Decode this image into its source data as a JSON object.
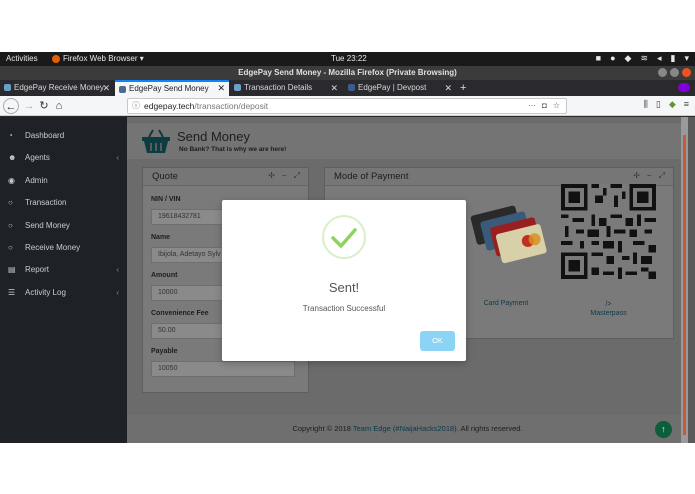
{
  "desktop": {
    "activities": "Activities",
    "app_menu": "Firefox Web Browser ▾",
    "clock": "Tue 23:22"
  },
  "window": {
    "title": "EdgePay Send Money - Mozilla Firefox (Private Browsing)"
  },
  "tabs": [
    {
      "label": "EdgePay Receive Money",
      "active": false
    },
    {
      "label": "EdgePay Send Money",
      "active": true
    },
    {
      "label": "Transaction Details",
      "active": false
    },
    {
      "label": "EdgePay | Devpost",
      "active": false
    }
  ],
  "urlbar": {
    "host": "edgepay.tech",
    "path": "/transaction/deposit"
  },
  "sidebar": {
    "items": [
      {
        "label": "Dashboard",
        "icon": "dashboard-icon",
        "has_children": false
      },
      {
        "label": "Agents",
        "icon": "users-icon",
        "has_children": true
      },
      {
        "label": "Admin",
        "icon": "user-circle-icon",
        "has_children": false
      },
      {
        "label": "Transaction",
        "icon": "circle-icon",
        "has_children": false
      },
      {
        "label": "Send Money",
        "icon": "circle-icon",
        "has_children": false
      },
      {
        "label": "Receive Money",
        "icon": "circle-icon",
        "has_children": false
      },
      {
        "label": "Report",
        "icon": "file-icon",
        "has_children": true
      },
      {
        "label": "Activity Log",
        "icon": "list-icon",
        "has_children": true
      }
    ]
  },
  "header": {
    "title": "Send Money",
    "subtitle": "No Bank? That is why we are here!"
  },
  "quote": {
    "title": "Quote",
    "fields": [
      {
        "label": "NIN / VIN",
        "value": "19618432781"
      },
      {
        "label": "Name",
        "value": "Ibijola, Adetayo Sylv"
      },
      {
        "label": "Amount",
        "value": "10000"
      },
      {
        "label": "Convenience Fee",
        "value": "50.00"
      },
      {
        "label": "Payable",
        "value": "10050"
      }
    ]
  },
  "payment": {
    "title": "Mode of Payment",
    "card_label": "Card Payment",
    "masterpass_top": "/>",
    "masterpass_label": "Masterpass"
  },
  "footer": {
    "prefix": "Copyright © 2018 ",
    "team": "Team Edge (#NaijaHacks2018)",
    "suffix": ". All rights reserved."
  },
  "modal": {
    "title": "Sent!",
    "message": "Transaction Successful",
    "ok_label": "OK"
  },
  "colors": {
    "accent_blue": "#0a84ff",
    "ok_button": "#8cd4f5",
    "success_green": "#8cd45a",
    "sidebar": "#1e2226"
  }
}
